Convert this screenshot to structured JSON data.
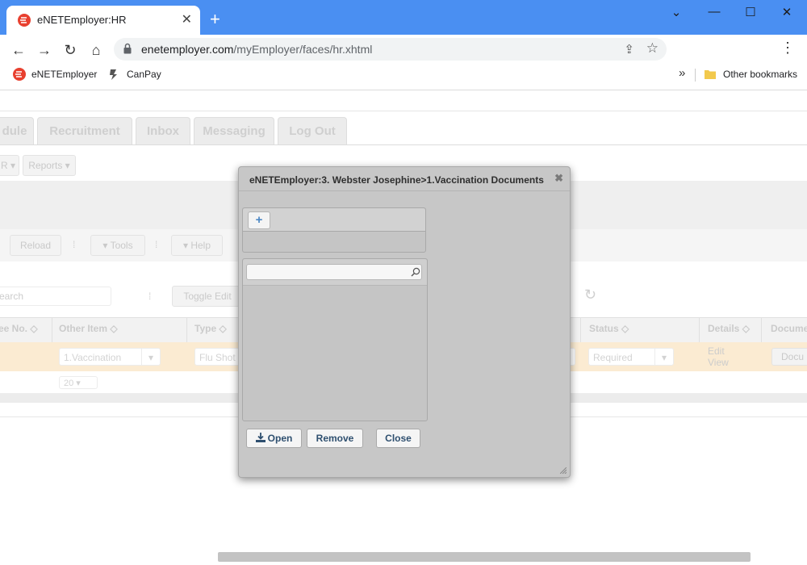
{
  "browser": {
    "tab_title": "eNETEmployer:HR",
    "tab_close": "✕",
    "new_tab": "+",
    "url_host": "enetemployer.com",
    "url_path": "/myEmployer/faces/hr.xhtml",
    "bookmarks": [
      {
        "label": "eNETEmployer"
      },
      {
        "label": "CanPay"
      }
    ],
    "other_bookmarks": "Other bookmarks",
    "overflow": "»"
  },
  "page": {
    "nav_tabs": [
      {
        "label": "dule"
      },
      {
        "label": "Recruitment"
      },
      {
        "label": "Inbox"
      },
      {
        "label": "Messaging"
      },
      {
        "label": "Log Out"
      }
    ],
    "submenu": [
      {
        "label": "R"
      },
      {
        "label": "Reports"
      }
    ],
    "toolbar": {
      "reload": "Reload",
      "tools": "Tools",
      "help": "Help"
    },
    "search_placeholder": "earch",
    "toggle_edit": "Toggle Edit",
    "columns": [
      {
        "label": "ee No."
      },
      {
        "label": "Other Item"
      },
      {
        "label": "Type"
      },
      {
        "label": "Status"
      },
      {
        "label": "Details"
      },
      {
        "label": "Docume"
      }
    ],
    "row": {
      "other_item": "1.Vaccination",
      "type": "Flu Shot",
      "status": "Required",
      "details_edit": "Edit",
      "details_view": "View",
      "document": "Docu"
    },
    "page_size": "20"
  },
  "dialog": {
    "title": "eNETEmployer:3. Webster Josephine>1.Vaccination Documents",
    "close": "✖",
    "add_label": "+",
    "search_value": "",
    "buttons": {
      "open": "Open",
      "remove": "Remove",
      "close": "Close"
    }
  }
}
